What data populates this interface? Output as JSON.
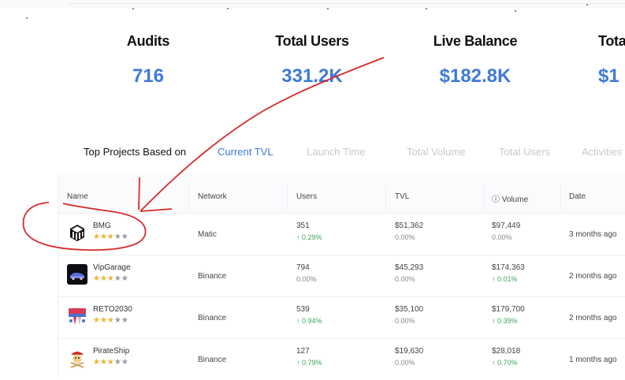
{
  "stats": [
    {
      "label": "Audits",
      "value": "716"
    },
    {
      "label": "Total Users",
      "value": "331.2K"
    },
    {
      "label": "Live Balance",
      "value": "$182.8K"
    },
    {
      "label": "Tota",
      "value": "$1"
    }
  ],
  "tabs": {
    "label": "Top Projects Based on",
    "items": [
      "Current TVL",
      "Launch Time",
      "Total Volume",
      "Total Users",
      "Activities"
    ]
  },
  "table": {
    "headers": [
      "Name",
      "Network",
      "Users",
      "TVL",
      "ⓘ Volume",
      "Date"
    ],
    "rows": [
      {
        "name": "BMG",
        "rating": 3,
        "network": "Matic",
        "users": "351",
        "users_change": "↑ 0.29%",
        "tvl": "$51,362",
        "tvl_change": "0.00%",
        "volume": "$97,449",
        "volume_change": "0.00%",
        "date": "3 months ago"
      },
      {
        "name": "VipGarage",
        "rating": 3,
        "network": "Binance",
        "users": "794",
        "users_change": "0.00%",
        "tvl": "$45,293",
        "tvl_change": "0.00%",
        "volume": "$174,363",
        "volume_change": "↑ 0.01%",
        "date": "2 months ago"
      },
      {
        "name": "RETO2030",
        "rating": 3,
        "network": "Binance",
        "users": "539",
        "users_change": "↑ 0.94%",
        "tvl": "$35,100",
        "tvl_change": "0.00%",
        "volume": "$179,700",
        "volume_change": "↑ 0.39%",
        "date": "2 months ago"
      },
      {
        "name": "PirateShip",
        "rating": 3,
        "network": "Binance",
        "users": "127",
        "users_change": "↑ 0.79%",
        "tvl": "$19,630",
        "tvl_change": "0.00%",
        "volume": "$28,018",
        "volume_change": "↑ 0.70%",
        "date": "1 months ago"
      }
    ]
  },
  "icons": [
    "bmg-logo-icon",
    "vipgarage-logo-icon",
    "reto2030-logo-icon",
    "pirateship-logo-icon",
    "star-icon"
  ],
  "colors": {
    "accent": "#3f7ad9",
    "positive": "#3aa55b",
    "star": "#f0b32c",
    "annotation": "#d62a2a"
  }
}
